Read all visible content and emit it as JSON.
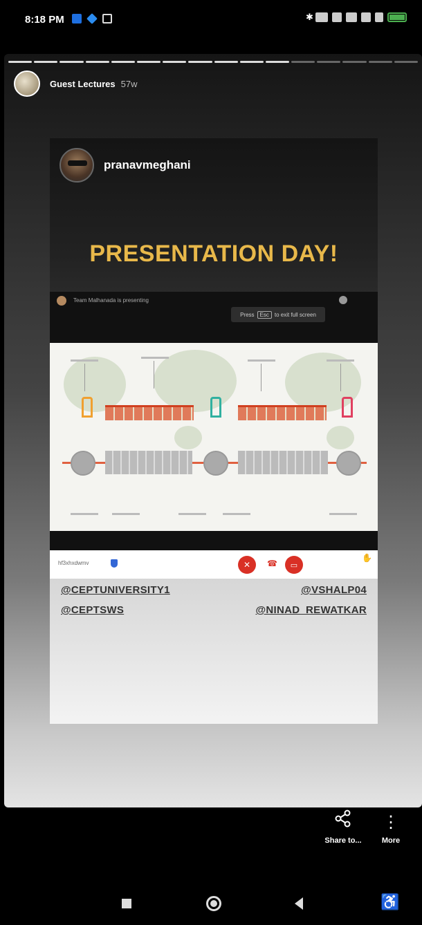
{
  "status_bar": {
    "time": "8:18 PM"
  },
  "story": {
    "account_name": "Guest Lectures",
    "age": "57w",
    "progress_segments_total": 16,
    "progress_segments_viewed": 11,
    "post": {
      "author": "pranavmeghani",
      "headline": "PRESENTATION DAY!",
      "call_screenshot": {
        "presenter_text": "Team Malhanada is presenting",
        "esc_hint_prefix": "Press",
        "esc_key": "Esc",
        "esc_hint_suffix": "to exit full screen",
        "meeting_code": "hf3xhxdwmv"
      },
      "mentions": {
        "left": [
          "@CEPTUNIVERSITY1",
          "@CEPTSWS"
        ],
        "right": [
          "@VSHALP04",
          "@NINAD_REWATKAR"
        ]
      }
    }
  },
  "actions": {
    "share_label": "Share to...",
    "more_label": "More"
  }
}
